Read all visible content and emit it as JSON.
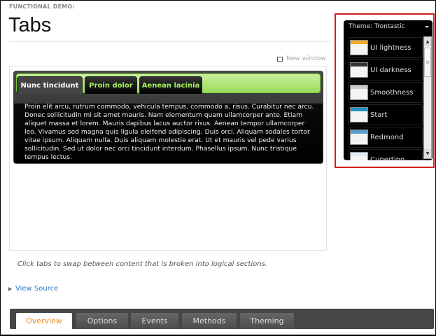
{
  "header": {
    "label": "FUNCTIONAL DEMO:",
    "title": "Tabs",
    "new_window": "New window"
  },
  "demo": {
    "tabs": [
      {
        "label": "Nunc tincidunt",
        "active": true
      },
      {
        "label": "Proin dolor"
      },
      {
        "label": "Aenean lacinia"
      }
    ],
    "content": "Proin elit arcu, rutrum commodo, vehicula tempus, commodo a, risus. Curabitur nec arcu. Donec sollicitudin mi sit amet mauris. Nam elementum quam ullamcorper ante. Etiam aliquet massa et lorem. Mauris dapibus lacus auctor risus. Aenean tempor ullamcorper leo. Vivamus sed magna quis ligula eleifend adipiscing. Duis orci. Aliquam sodales tortor vitae ipsum. Aliquam nulla. Duis aliquam molestie erat. Ut et mauris vel pede varius sollicitudin. Sed ut dolor nec orci tincidunt interdum. Phasellus ipsum. Nunc tristique tempus lectus."
  },
  "caption": "Click tabs to swap between content that is broken into logical sections.",
  "view_source": "View Source",
  "bottom_tabs": [
    {
      "label": "Overview",
      "active": true
    },
    {
      "label": "Options"
    },
    {
      "label": "Events"
    },
    {
      "label": "Methods"
    },
    {
      "label": "Theming"
    }
  ],
  "theme_switcher": {
    "title": "Theme: Trontastic",
    "items": [
      {
        "label": "UI lightness",
        "color": "#f6a828"
      },
      {
        "label": "UI darkness",
        "color": "#333333"
      },
      {
        "label": "Smoothness",
        "color": "#cccccc"
      },
      {
        "label": "Start",
        "color": "#2191c0"
      },
      {
        "label": "Redmond",
        "color": "#5c9ccc"
      },
      {
        "label": "Cupertino",
        "color": "#deedf7"
      }
    ]
  },
  "colors": {
    "highlight_border": "#d02020",
    "tab_green": "#a6f061",
    "link": "#2a7bc8",
    "active_bottom_tab": "#f08a24"
  }
}
